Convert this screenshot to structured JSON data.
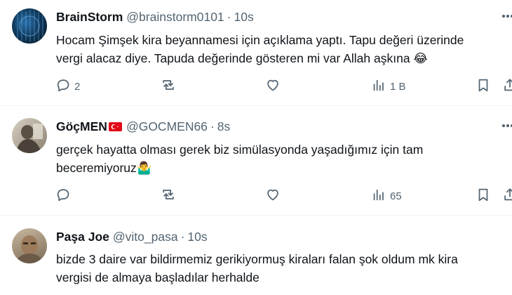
{
  "tweets": [
    {
      "name": "BrainStorm",
      "handle": "@brainstorm0101",
      "separator": "·",
      "time": "10s",
      "text_lines": [
        "Hocam Şimşek kira beyannamesi için açıklama yaptı. Tapu değeri üzerinde",
        "vergi alacaz diye. Tapuda değerinde gösteren mi var Allah aşkına 😂"
      ],
      "replies": "2",
      "reposts": "",
      "likes": "",
      "views": "1 B"
    },
    {
      "name": "GöçMEN",
      "flag": "turkey-flag",
      "handle": "@GOCMEN66",
      "separator": "·",
      "time": "8s",
      "text_lines": [
        "gerçek hayatta olması gerek biz simülasyonda yaşadığımız için tam",
        "beceremiyoruz🤷‍♂️"
      ],
      "replies": "",
      "reposts": "",
      "likes": "",
      "views": "65"
    },
    {
      "name": "Paşa Joe",
      "handle": "@vito_pasa",
      "separator": "·",
      "time": "10s",
      "text_lines": [
        "bizde 3 daire var bildirmemiz gerikiyormuş kiraları falan şok oldum mk kira",
        "vergisi de almaya başladılar herhalde"
      ]
    }
  ],
  "icons": {
    "reply": "reply-icon",
    "repost": "repost-icon",
    "like": "heart-icon",
    "views": "views-icon",
    "bookmark": "bookmark-icon",
    "share": "share-icon",
    "more": "more-icon"
  },
  "colors": {
    "text": "#0f1419",
    "secondary": "#536471",
    "divider": "#eff3f4",
    "flag_red": "#e30a17"
  }
}
